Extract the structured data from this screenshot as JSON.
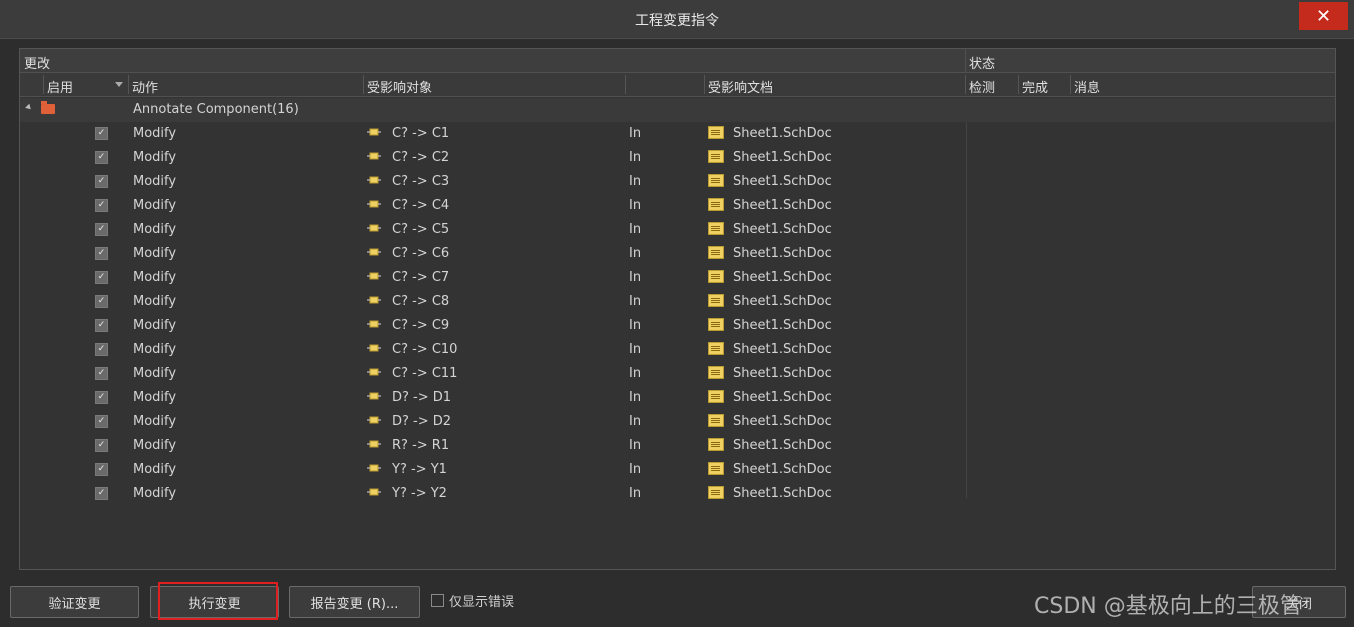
{
  "window": {
    "title": "工程变更指令",
    "close_label": "✕"
  },
  "groups": {
    "changes": "更改",
    "status": "状态"
  },
  "columns": {
    "enable": "启用",
    "action": "动作",
    "affected_object": "受影响对象",
    "affected_doc": "受影响文档",
    "check": "检测",
    "done": "完成",
    "message": "消息"
  },
  "group_row": {
    "label": "Annotate Component(16)"
  },
  "rows": [
    {
      "action": "Modify",
      "object": "C? -> C1",
      "dir": "In",
      "doc": "Sheet1.SchDoc"
    },
    {
      "action": "Modify",
      "object": "C? -> C2",
      "dir": "In",
      "doc": "Sheet1.SchDoc"
    },
    {
      "action": "Modify",
      "object": "C? -> C3",
      "dir": "In",
      "doc": "Sheet1.SchDoc"
    },
    {
      "action": "Modify",
      "object": "C? -> C4",
      "dir": "In",
      "doc": "Sheet1.SchDoc"
    },
    {
      "action": "Modify",
      "object": "C? -> C5",
      "dir": "In",
      "doc": "Sheet1.SchDoc"
    },
    {
      "action": "Modify",
      "object": "C? -> C6",
      "dir": "In",
      "doc": "Sheet1.SchDoc"
    },
    {
      "action": "Modify",
      "object": "C? -> C7",
      "dir": "In",
      "doc": "Sheet1.SchDoc"
    },
    {
      "action": "Modify",
      "object": "C? -> C8",
      "dir": "In",
      "doc": "Sheet1.SchDoc"
    },
    {
      "action": "Modify",
      "object": "C? -> C9",
      "dir": "In",
      "doc": "Sheet1.SchDoc"
    },
    {
      "action": "Modify",
      "object": "C? -> C10",
      "dir": "In",
      "doc": "Sheet1.SchDoc"
    },
    {
      "action": "Modify",
      "object": "C? -> C11",
      "dir": "In",
      "doc": "Sheet1.SchDoc"
    },
    {
      "action": "Modify",
      "object": "D? -> D1",
      "dir": "In",
      "doc": "Sheet1.SchDoc"
    },
    {
      "action": "Modify",
      "object": "D? -> D2",
      "dir": "In",
      "doc": "Sheet1.SchDoc"
    },
    {
      "action": "Modify",
      "object": "R? -> R1",
      "dir": "In",
      "doc": "Sheet1.SchDoc"
    },
    {
      "action": "Modify",
      "object": "Y? -> Y1",
      "dir": "In",
      "doc": "Sheet1.SchDoc"
    },
    {
      "action": "Modify",
      "object": "Y? -> Y2",
      "dir": "In",
      "doc": "Sheet1.SchDoc"
    }
  ],
  "footer": {
    "validate": "验证变更",
    "execute": "执行变更",
    "report": "报告变更 (R)...",
    "only_errors": "仅显示错误",
    "close": "关闭"
  },
  "watermark": "CSDN @基极向上的三极管"
}
